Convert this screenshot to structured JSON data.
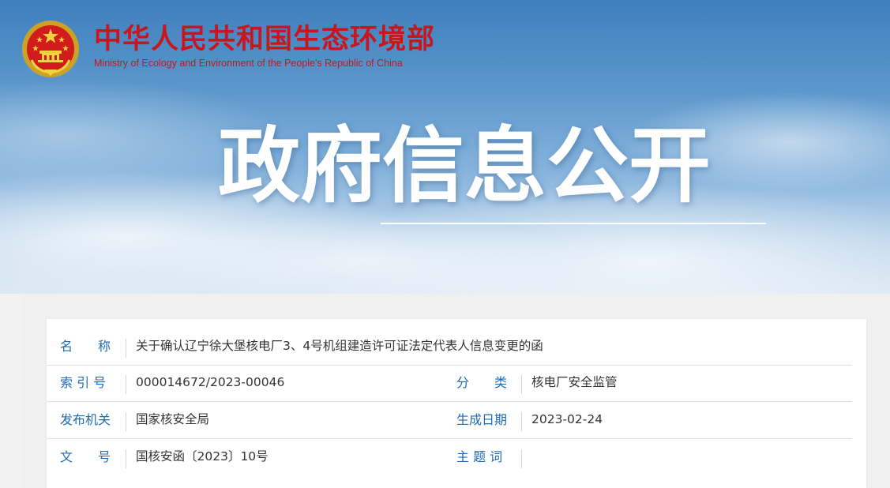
{
  "header": {
    "org_name_cn": "中华人民共和国生态环境部",
    "org_name_en": "Ministry of Ecology and Environment of the People's Republic of China",
    "logo_icon": "national-emblem-icon"
  },
  "hero": {
    "title": "政府信息公开"
  },
  "colors": {
    "brand_red": "#c7161d",
    "label_blue": "#1f6bb4",
    "text_gray": "#333333"
  },
  "info": {
    "name_label": "名　　称",
    "name_value": "关于确认辽宁徐大堡核电厂3、4号机组建造许可证法定代表人信息变更的函",
    "index_label": "索 引 号",
    "index_value": "000014672/2023-00046",
    "category_label": "分　　类",
    "category_value": "核电厂安全监管",
    "issuer_label": "发布机关",
    "issuer_value": "国家核安全局",
    "date_label": "生成日期",
    "date_value": "2023-02-24",
    "docno_label": "文　　号",
    "docno_value": "国核安函〔2023〕10号",
    "keywords_label": "主 题 词",
    "keywords_value": ""
  }
}
